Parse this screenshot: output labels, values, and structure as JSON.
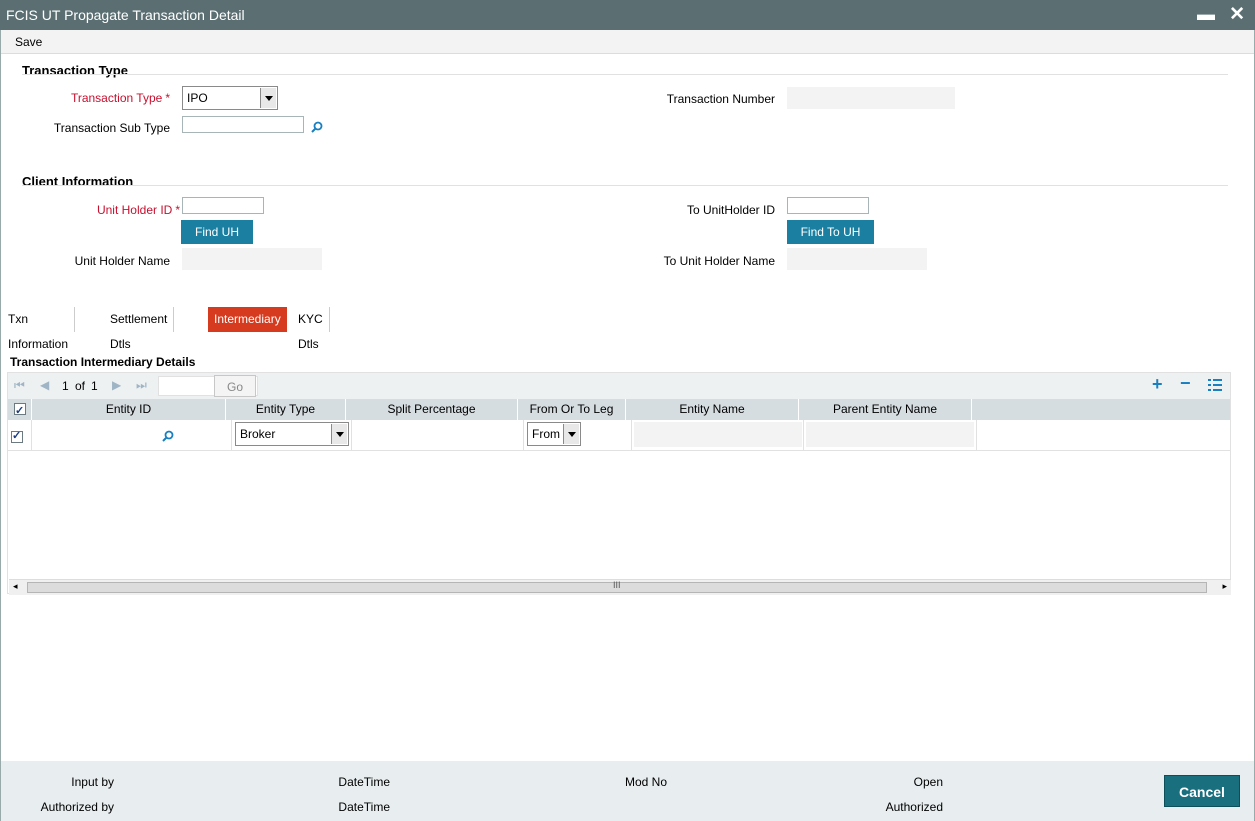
{
  "window": {
    "title": "FCIS UT Propagate Transaction Detail",
    "minimize_glyph": "▬",
    "close_glyph": "✕"
  },
  "toolbar": {
    "save_label": "Save"
  },
  "transaction_type_section": {
    "title": "Transaction Type",
    "transaction_type_label": "Transaction Type",
    "transaction_type_value": "IPO",
    "transaction_sub_type_label": "Transaction Sub Type",
    "transaction_sub_type_value": "",
    "transaction_number_label": "Transaction Number",
    "transaction_number_value": ""
  },
  "client_section": {
    "title": "Client Information",
    "unit_holder_id_label": "Unit Holder ID",
    "unit_holder_id_value": "",
    "find_uh_label": "Find UH",
    "unit_holder_name_label": "Unit Holder Name",
    "unit_holder_name_value": "",
    "to_unitholder_id_label": "To UnitHolder ID",
    "to_unitholder_id_value": "",
    "find_to_uh_label": "Find To UH",
    "to_unit_holder_name_label": "To Unit Holder Name",
    "to_unit_holder_name_value": ""
  },
  "required_marker": "*",
  "tabs": [
    {
      "label": "Txn Information",
      "active": false
    },
    {
      "label": "Settlement Dtls",
      "active": false
    },
    {
      "label": "Intermediary",
      "active": true
    },
    {
      "label": "KYC Dtls",
      "active": false
    }
  ],
  "grid": {
    "title": "Transaction Intermediary Details",
    "page_current": "1",
    "page_of": "of",
    "page_total": "1",
    "go_label": "Go",
    "columns": [
      "Entity ID",
      "Entity Type",
      "Split Percentage",
      "From Or To Leg",
      "Entity Name",
      "Parent Entity Name"
    ],
    "rows": [
      {
        "entity_id": "",
        "entity_type": "Broker",
        "split_percentage": "",
        "from_or_to_leg": "From",
        "entity_name": "",
        "parent_entity_name": ""
      }
    ],
    "scroll_grip": "III"
  },
  "footer": {
    "input_by": "Input by",
    "authorized_by": "Authorized by",
    "datetime_1": "DateTime",
    "datetime_2": "DateTime",
    "mod_no": "Mod No",
    "open": "Open",
    "authorized": "Authorized",
    "cancel_label": "Cancel"
  },
  "colors": {
    "titlebar": "#5b6f73",
    "accent_button": "#1a7fa0",
    "active_tab": "#d63b1f",
    "required": "#c8102e",
    "cancel": "#1a6f7f"
  }
}
